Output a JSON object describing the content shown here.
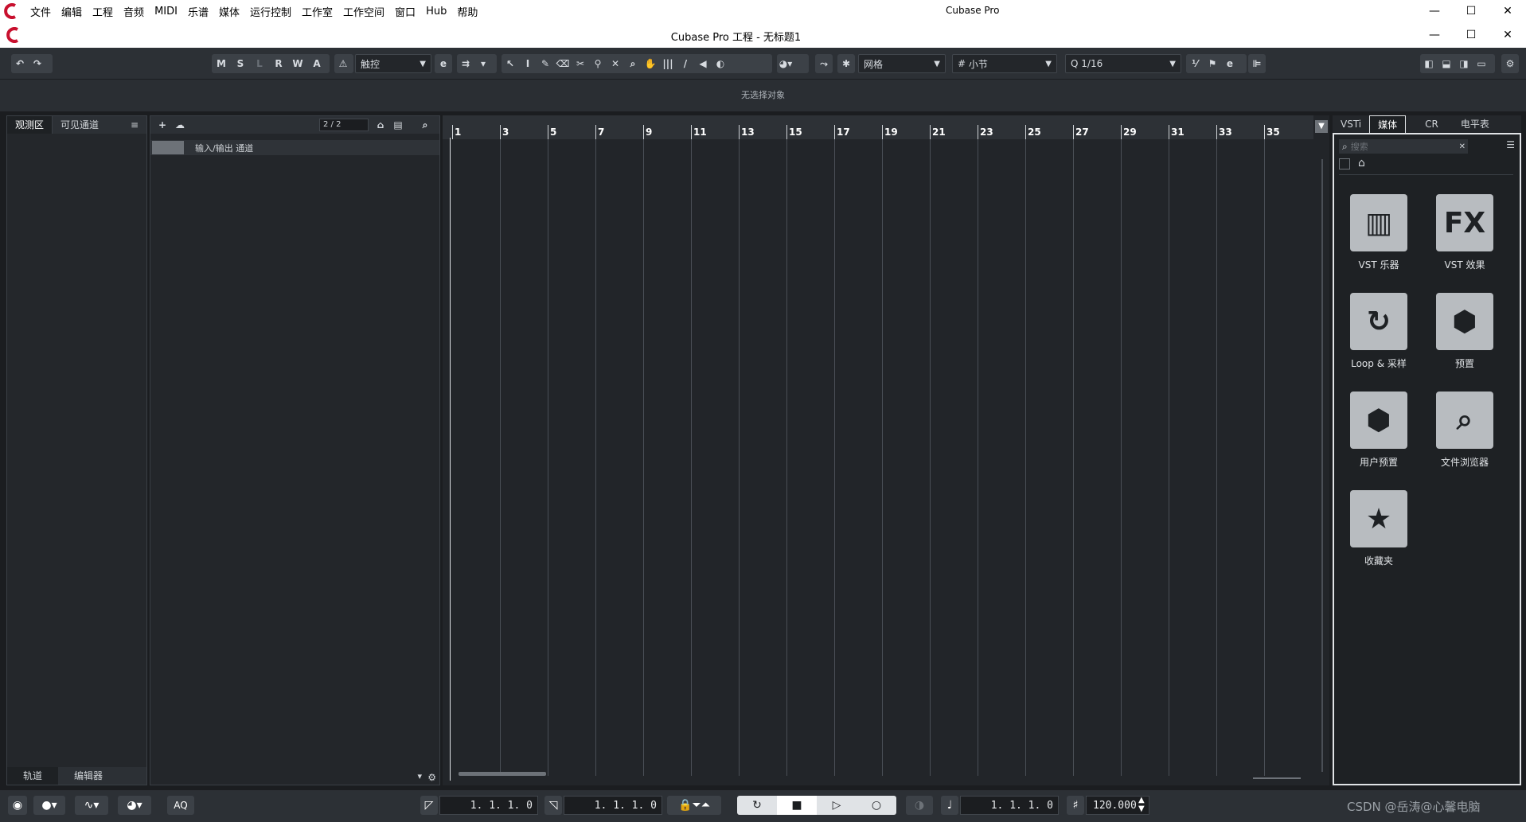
{
  "app": {
    "title": "Cubase Pro",
    "project_title": "Cubase Pro 工程 - 无标题1"
  },
  "menu": [
    "文件",
    "编辑",
    "工程",
    "音频",
    "MIDI",
    "乐谱",
    "媒体",
    "运行控制",
    "工作室",
    "工作空间",
    "窗口",
    "Hub",
    "帮助"
  ],
  "window_buttons": {
    "minimize": "—",
    "maximize": "☐",
    "close": "✕"
  },
  "toolbar": {
    "state_buttons": [
      "M",
      "S",
      "L",
      "R",
      "W",
      "A"
    ],
    "automation_mode": "触控",
    "snap_type": "网格",
    "grid_type": "小节",
    "quantize": "1/16"
  },
  "info_line": "无选择对象",
  "left_zone": {
    "tabs": [
      "观测区",
      "可见通道"
    ],
    "bottom_tabs": [
      "轨道",
      "编辑器"
    ]
  },
  "track_list": {
    "counter": "2 / 2",
    "tracks": [
      {
        "name": "输入/输出 通道"
      }
    ]
  },
  "ruler": {
    "bars": [
      "1",
      "3",
      "5",
      "7",
      "9",
      "11",
      "13",
      "15",
      "17",
      "19",
      "21",
      "23",
      "25",
      "27",
      "29",
      "31",
      "33",
      "35"
    ]
  },
  "right_zone": {
    "tabs": [
      "VSTi",
      "媒体",
      "CR",
      "电平表"
    ],
    "active_tab": "媒体",
    "search_placeholder": "搜索",
    "tiles": [
      {
        "label": "VST 乐器",
        "icon": "piano-icon"
      },
      {
        "label": "VST 效果",
        "icon": "fx-icon"
      },
      {
        "label": "Loop & 采样",
        "icon": "loop-icon"
      },
      {
        "label": "预置",
        "icon": "preset-icon"
      },
      {
        "label": "用户预置",
        "icon": "user-preset-icon"
      },
      {
        "label": "文件浏览器",
        "icon": "file-browser-icon"
      },
      {
        "label": "收藏夹",
        "icon": "star-icon"
      }
    ]
  },
  "transport": {
    "left_locator": "1. 1. 1.   0",
    "right_locator": "1. 1. 1.   0",
    "position": "1. 1. 1.   0",
    "tempo": "120.000",
    "aq_label": "AQ"
  },
  "watermark": "CSDN @岳涛@心馨电脑"
}
